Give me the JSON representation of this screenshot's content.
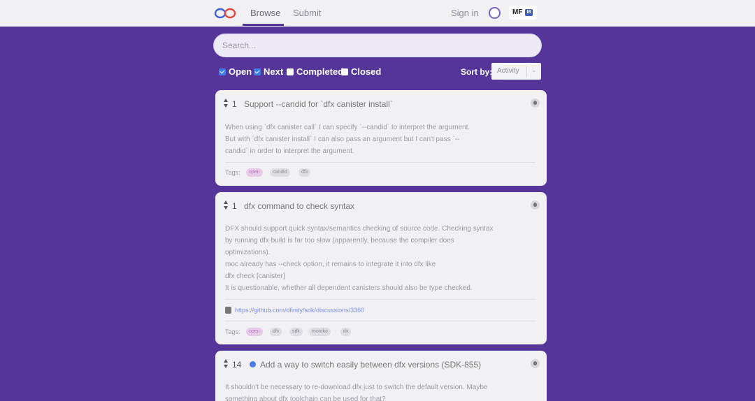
{
  "nav": {
    "tabs": [
      {
        "label": "Browse",
        "active": true
      },
      {
        "label": "Submit",
        "active": false
      }
    ],
    "signin": "Sign in",
    "lang": "MF",
    "flag": "M"
  },
  "search": {
    "placeholder": "Search..."
  },
  "filters": [
    {
      "label": "Open",
      "checked": true
    },
    {
      "label": "Next",
      "checked": true
    },
    {
      "label": "Completed",
      "checked": false
    },
    {
      "label": "Closed",
      "checked": false
    }
  ],
  "sort": {
    "label": "Sort by:",
    "value": "Activity"
  },
  "cards": [
    {
      "votes": "1",
      "title": "Support --candid for `dfx canister install`",
      "body": [
        "When using `dfx canister call` I can specify `--candid` to interpret the argument.",
        "But with `dfx canister install` I can also pass an argument but I can't pass `--",
        "candid` in order to interpret the argument."
      ],
      "tags_label": "Tags:",
      "tags": [
        "open",
        "candid",
        "dfx"
      ]
    },
    {
      "votes": "1",
      "title": "dfx command to check syntax",
      "body": [
        "DFX should support quick syntax/semantics checking of source code. Checking syntax",
        "by running dfx build is far too slow (apparently, because the compiler does",
        "optimizations).",
        "moc already has --check option, it remains to integrate it into dfx like",
        "dfx check [canister]",
        "It is questionable, whether all dependent canisters should also be type checked."
      ],
      "link": "https://github.com/dfinity/sdk/discussions/3360",
      "tags_label": "Tags:",
      "tags": [
        "open",
        "dfx",
        "sdk",
        "motoko",
        "dx"
      ]
    },
    {
      "votes": "14",
      "title": "Add a way to switch easily between dfx versions (SDK-855)",
      "body": [
        "It shouldn't be necessary to re-download dfx just to switch the default version. Maybe",
        "something about dfx toolchain can be used for that?"
      ]
    }
  ]
}
